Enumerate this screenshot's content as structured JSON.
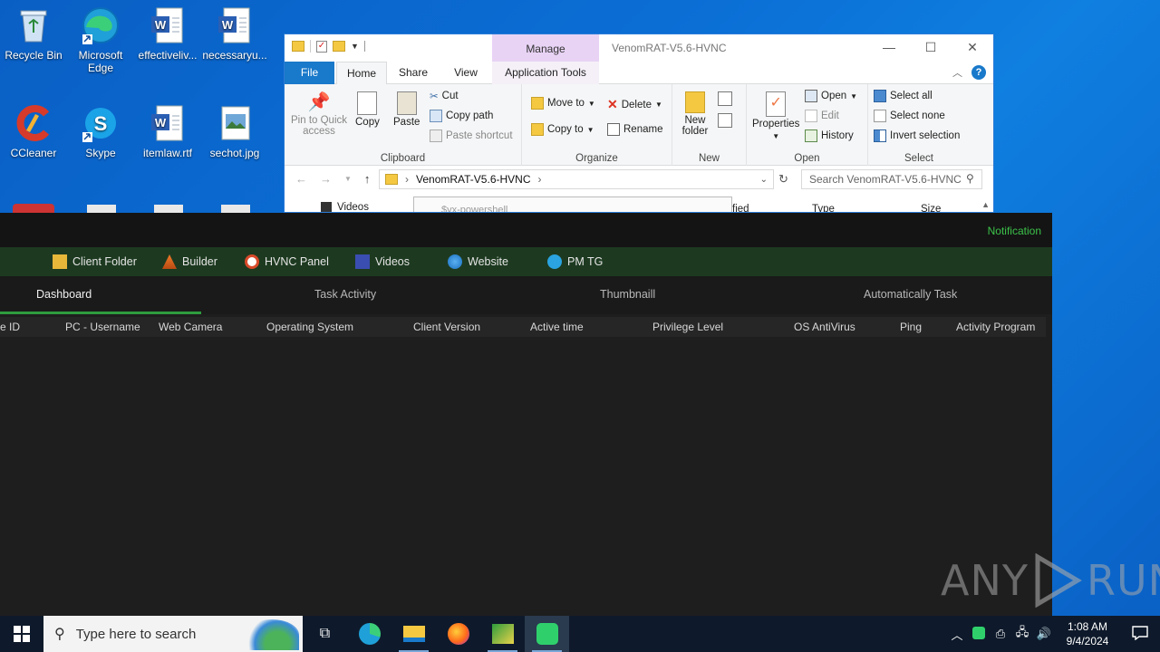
{
  "desktop": {
    "icons": [
      {
        "label": "Recycle Bin"
      },
      {
        "label": "Microsoft Edge"
      },
      {
        "label": "effectiveliv..."
      },
      {
        "label": "necessaryu..."
      },
      {
        "label": "CCleaner"
      },
      {
        "label": "Skype"
      },
      {
        "label": "itemlaw.rtf"
      },
      {
        "label": "sechot.jpg"
      }
    ]
  },
  "explorer": {
    "title": "VenomRAT-V5.6-HVNC",
    "manage_tab": "Manage",
    "tabs": {
      "file": "File",
      "home": "Home",
      "share": "Share",
      "view": "View",
      "app_tools": "Application Tools"
    },
    "clipboard": {
      "pin": "Pin to Quick access",
      "copy": "Copy",
      "paste": "Paste",
      "cut": "Cut",
      "copy_path": "Copy path",
      "paste_shortcut": "Paste shortcut",
      "label": "Clipboard"
    },
    "organize": {
      "move_to": "Move to",
      "copy_to": "Copy to",
      "delete": "Delete",
      "rename": "Rename",
      "label": "Organize"
    },
    "new": {
      "new_folder": "New folder",
      "label": "New"
    },
    "open": {
      "properties": "Properties",
      "open": "Open",
      "edit": "Edit",
      "history": "History",
      "label": "Open"
    },
    "select": {
      "select_all": "Select all",
      "select_none": "Select none",
      "invert": "Invert selection",
      "label": "Select"
    },
    "address": {
      "path": "VenomRAT-V5.6-HVNC",
      "search_placeholder": "Search VenomRAT-V5.6-HVNC"
    },
    "list_peek": {
      "videos": "Videos",
      "popup": "$vx-powershell",
      "modified": "fied",
      "type": "Type",
      "size": "Size"
    }
  },
  "rat": {
    "notification": "Notification",
    "toolbar": [
      {
        "label": "Client Folder",
        "icon": "folder-icon"
      },
      {
        "label": "Builder",
        "icon": "builder-icon"
      },
      {
        "label": "HVNC Panel",
        "icon": "hvnc-icon"
      },
      {
        "label": "Videos",
        "icon": "video-icon"
      },
      {
        "label": "Website",
        "icon": "globe-icon"
      },
      {
        "label": "PM TG",
        "icon": "telegram-icon"
      }
    ],
    "tabs": [
      "Dashboard",
      "Task Activity",
      "Thumbnaill",
      "Automatically Task"
    ],
    "columns": [
      "e ID",
      "PC - Username",
      "Web Camera",
      "Operating System",
      "Client Version",
      "Active time",
      "Privilege Level",
      "OS AntiVirus",
      "Ping",
      "Activity Program"
    ]
  },
  "watermark": {
    "left": "ANY",
    "right": "RUN"
  },
  "taskbar": {
    "search_placeholder": "Type here to search",
    "time": "1:08 AM",
    "date": "9/4/2024"
  },
  "colors": {
    "accent_green": "#2e9c3d",
    "notification_green": "#3cc24a",
    "explorer_blue": "#1979ca"
  }
}
